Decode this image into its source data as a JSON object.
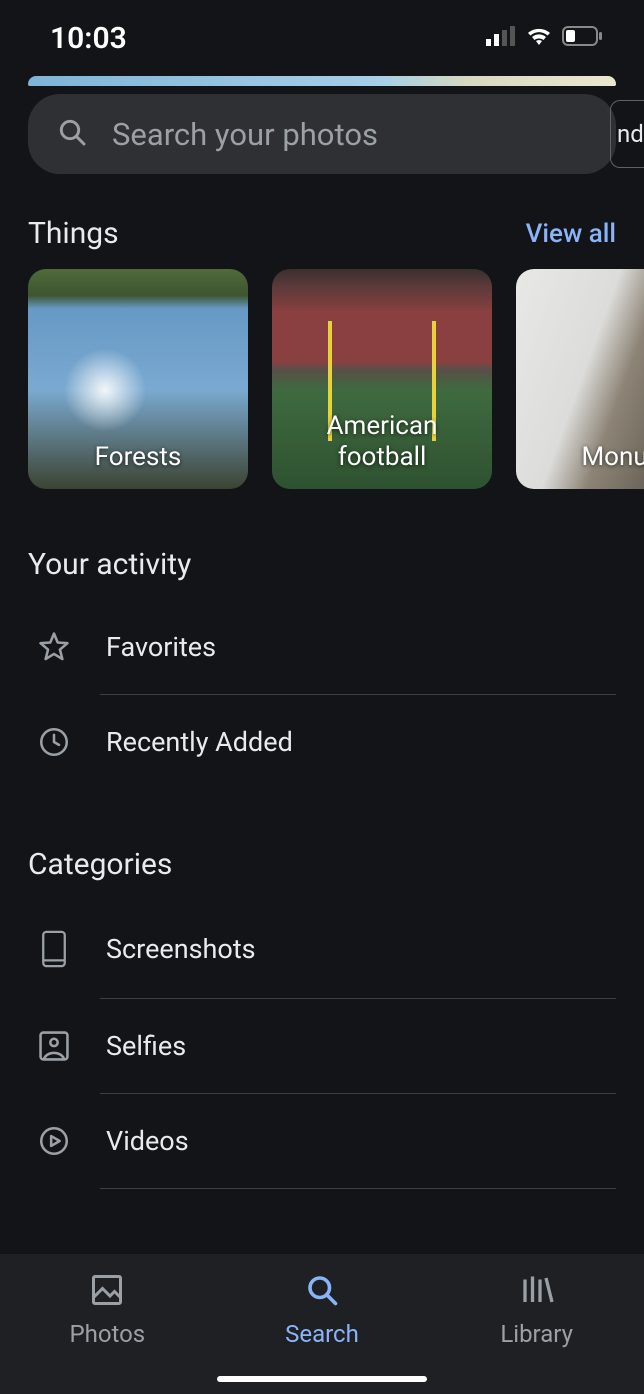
{
  "status": {
    "time": "10:03"
  },
  "search": {
    "placeholder": "Search your photos",
    "chip_edge": "nda"
  },
  "things": {
    "title": "Things",
    "view_all": "View all",
    "items": [
      {
        "label": "Forests"
      },
      {
        "label": "American\nfootball"
      },
      {
        "label": "Monum"
      }
    ]
  },
  "activity": {
    "title": "Your activity",
    "items": [
      {
        "label": "Favorites"
      },
      {
        "label": "Recently Added"
      }
    ]
  },
  "categories": {
    "title": "Categories",
    "items": [
      {
        "label": "Screenshots"
      },
      {
        "label": "Selfies"
      },
      {
        "label": "Videos"
      }
    ]
  },
  "nav": {
    "photos": "Photos",
    "search": "Search",
    "library": "Library"
  }
}
